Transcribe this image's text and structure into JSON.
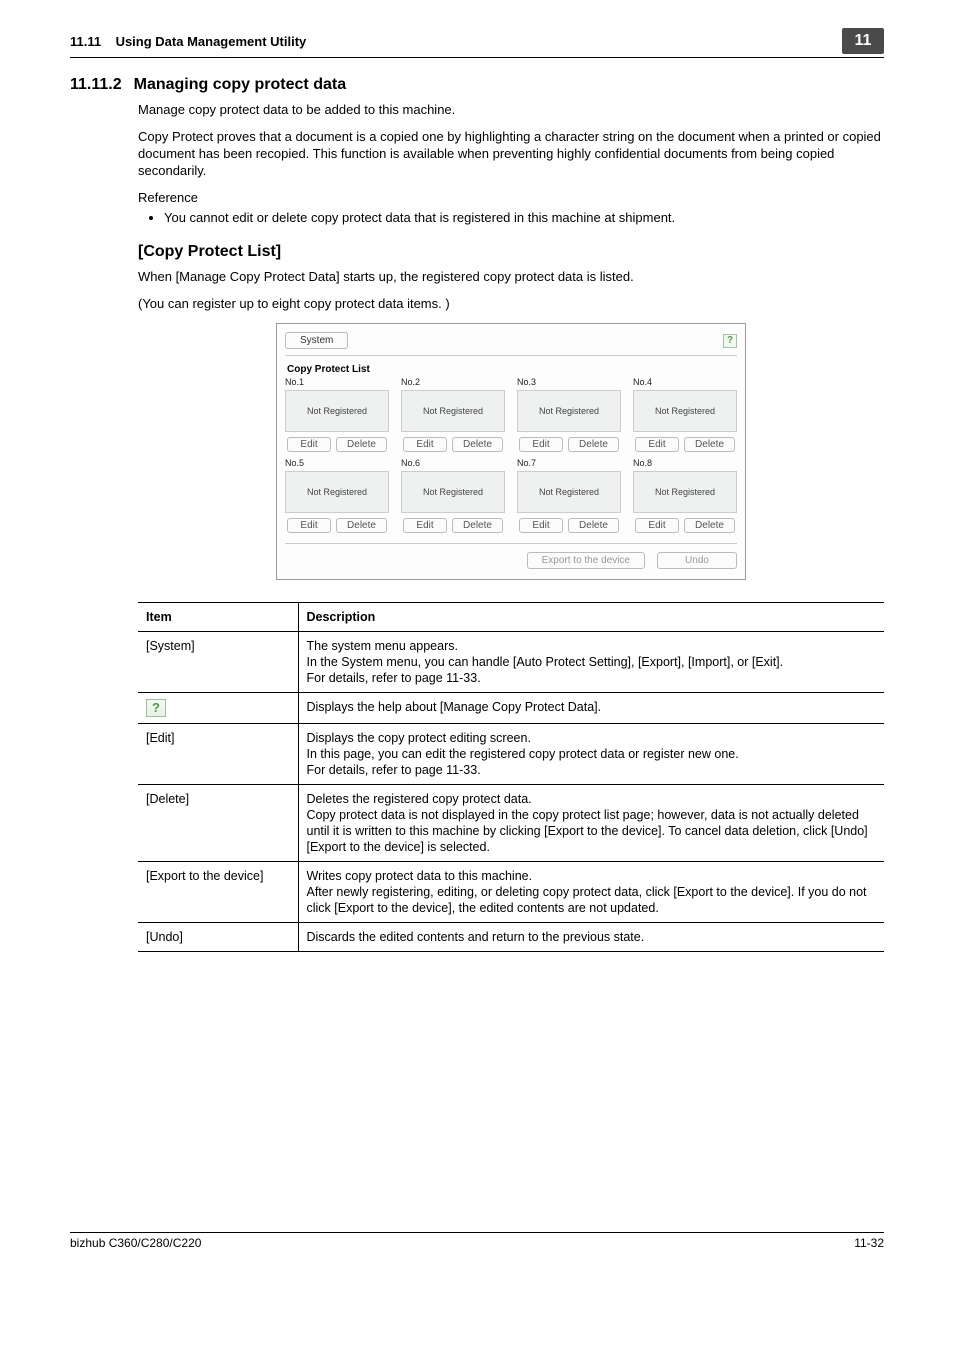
{
  "header": {
    "section_ref": "11.11",
    "section_label": "Using Data Management Utility",
    "chapter_badge": "11"
  },
  "section": {
    "number": "11.11.2",
    "title": "Managing copy protect data",
    "para1": "Manage copy protect data to be added to this machine.",
    "para2": "Copy Protect proves that a document is a copied one by highlighting a character string on the document when a printed or copied document has been recopied. This function is available when preventing highly confidential documents from being copied secondarily.",
    "reference_label": "Reference",
    "reference_bullet": "You cannot edit or delete copy protect data that is registered in this machine at shipment."
  },
  "copy_protect_list": {
    "heading": "[Copy Protect List]",
    "para1": "When [Manage Copy Protect Data] starts up, the registered copy protect data is listed.",
    "para2": "(You can register up to eight copy protect data items. )"
  },
  "app_shot": {
    "system_btn": "System",
    "help_glyph": "?",
    "list_title": "Copy Protect List",
    "not_registered": "Not Registered",
    "edit_btn": "Edit",
    "delete_btn": "Delete",
    "export_btn": "Export to the device",
    "undo_btn": "Undo",
    "slots": [
      "No.1",
      "No.2",
      "No.3",
      "No.4",
      "No.5",
      "No.6",
      "No.7",
      "No.8"
    ]
  },
  "table": {
    "head_item": "Item",
    "head_desc": "Description",
    "rows": [
      {
        "item": "[System]",
        "desc": "The system menu appears.\nIn the System menu, you can handle [Auto Protect Setting], [Export], [Import], or [Exit].\nFor details, refer to page 11-33."
      },
      {
        "item_is_icon": true,
        "icon_glyph": "?",
        "desc": "Displays the help about [Manage Copy Protect Data]."
      },
      {
        "item": "[Edit]",
        "desc": "Displays the copy protect editing screen.\nIn this page, you can edit the registered copy protect data or register new one.\nFor details, refer to page 11-33."
      },
      {
        "item": "[Delete]",
        "desc": "Deletes the registered copy protect data.\nCopy protect data is not displayed in the copy protect list page; however, data is not actually deleted until it is written to this machine by clicking [Export to the device]. To cancel data deletion, click [Undo] [Export to the device] is selected."
      },
      {
        "item": "[Export to the device]",
        "desc": "Writes copy protect data to this machine.\nAfter newly registering, editing, or deleting copy protect data, click [Export to the device]. If you do not click [Export to the device], the edited contents are not updated."
      },
      {
        "item": "[Undo]",
        "desc": "Discards the edited contents and return to the previous state."
      }
    ]
  },
  "footer": {
    "model": "bizhub C360/C280/C220",
    "page": "11-32"
  }
}
